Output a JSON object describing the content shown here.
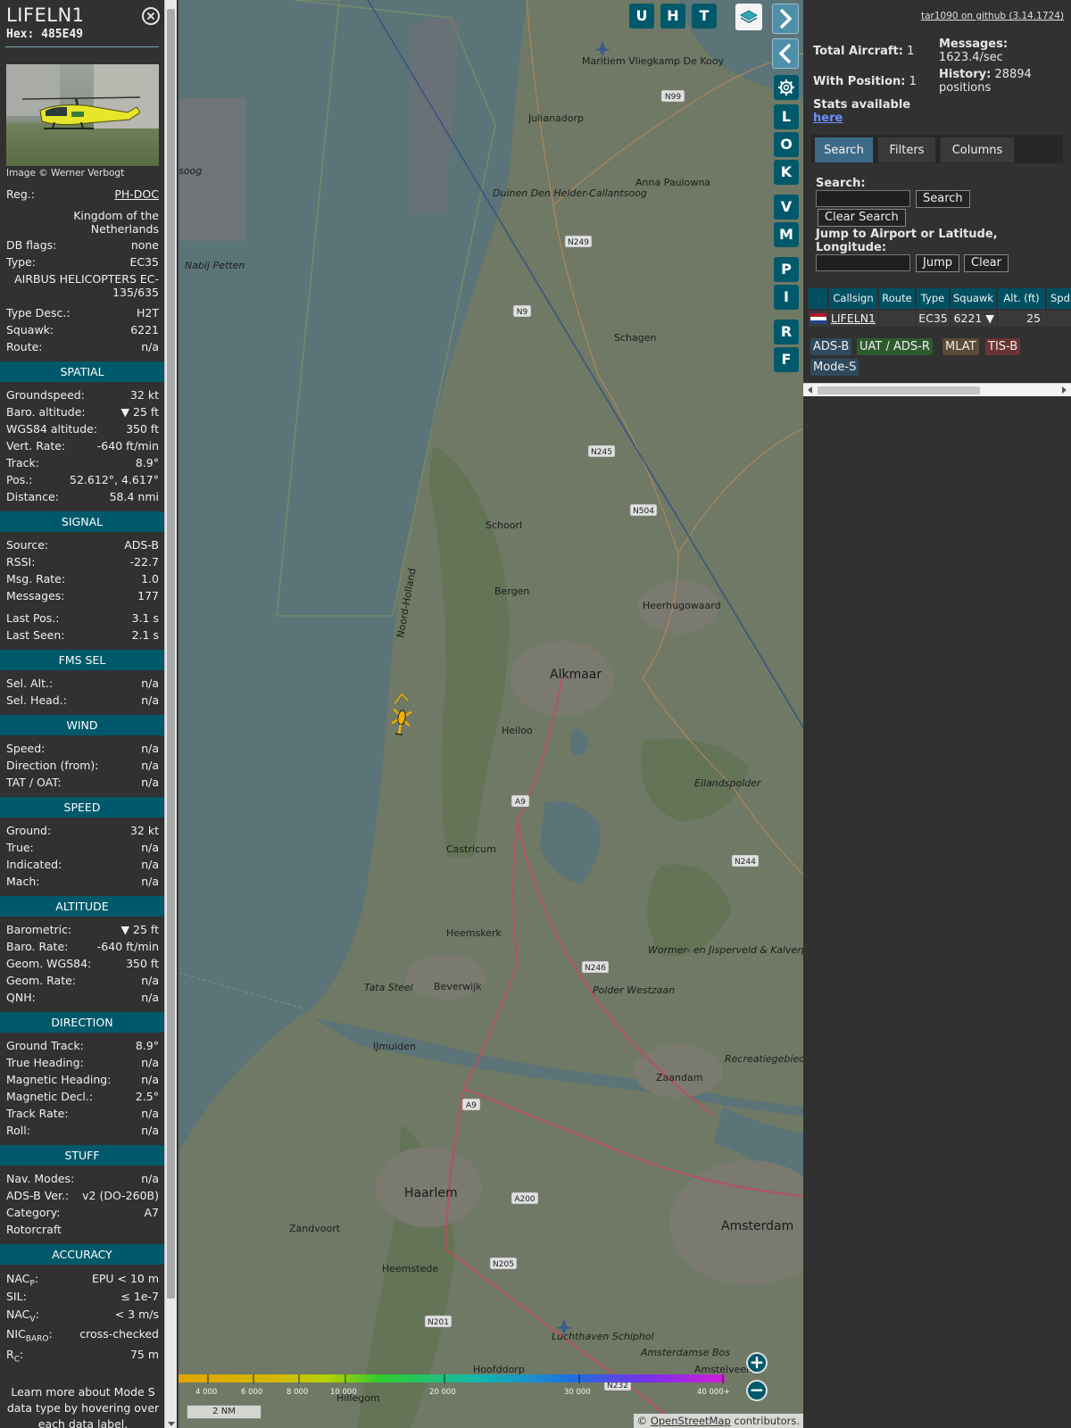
{
  "aircraft": {
    "callsign": "LIFELN1",
    "hex_label": "Hex: 485E49",
    "photo_credit": "Image © Werner Verbogt",
    "reg_label": "Reg.:",
    "reg": "PH-DOC",
    "country": "Kingdom of the Netherlands",
    "dbflags_label": "DB flags:",
    "dbflags": "none",
    "type_label": "Type:",
    "type": "EC35",
    "type_full": "AIRBUS HELICOPTERS EC-135/635",
    "typedesc_label": "Type Desc.:",
    "typedesc": "H2T",
    "squawk_label": "Squawk:",
    "squawk": "6221",
    "route_label": "Route:",
    "route": "n/a"
  },
  "sections": {
    "spatial": {
      "title": "SPATIAL",
      "rows": [
        {
          "label": "Groundspeed:",
          "value": "32 kt"
        },
        {
          "label": "Baro. altitude:",
          "value": "▼ 25 ft"
        },
        {
          "label": "WGS84 altitude:",
          "value": "350 ft"
        },
        {
          "label": "Vert. Rate:",
          "value": "-640 ft/min"
        },
        {
          "label": "Track:",
          "value": "8.9°"
        },
        {
          "label": "Pos.:",
          "value": "52.612°, 4.617°"
        },
        {
          "label": "Distance:",
          "value": "58.4 nmi"
        }
      ]
    },
    "signal": {
      "title": "SIGNAL",
      "rows": [
        {
          "label": "Source:",
          "value": "ADS-B"
        },
        {
          "label": "RSSI:",
          "value": "-22.7"
        },
        {
          "label": "Msg. Rate:",
          "value": "1.0"
        },
        {
          "label": "Messages:",
          "value": "177"
        },
        {
          "label": "Last Pos.:",
          "value": "3.1 s"
        },
        {
          "label": "Last Seen:",
          "value": "2.1 s"
        }
      ]
    },
    "fms": {
      "title": "FMS SEL",
      "rows": [
        {
          "label": "Sel. Alt.:",
          "value": "n/a"
        },
        {
          "label": "Sel. Head.:",
          "value": "n/a"
        }
      ]
    },
    "wind": {
      "title": "WIND",
      "rows": [
        {
          "label": "Speed:",
          "value": "n/a"
        },
        {
          "label": "Direction (from):",
          "value": "n/a"
        },
        {
          "label": "TAT / OAT:",
          "value": "n/a"
        }
      ]
    },
    "speed": {
      "title": "SPEED",
      "rows": [
        {
          "label": "Ground:",
          "value": "32 kt"
        },
        {
          "label": "True:",
          "value": "n/a"
        },
        {
          "label": "Indicated:",
          "value": "n/a"
        },
        {
          "label": "Mach:",
          "value": "n/a"
        }
      ]
    },
    "altitude": {
      "title": "ALTITUDE",
      "rows": [
        {
          "label": "Barometric:",
          "value": "▼ 25 ft"
        },
        {
          "label": "Baro. Rate:",
          "value": "-640 ft/min"
        },
        {
          "label": "Geom. WGS84:",
          "value": "350 ft"
        },
        {
          "label": "Geom. Rate:",
          "value": "n/a"
        },
        {
          "label": "QNH:",
          "value": "n/a"
        }
      ]
    },
    "direction": {
      "title": "DIRECTION",
      "rows": [
        {
          "label": "Ground Track:",
          "value": "8.9°"
        },
        {
          "label": "True Heading:",
          "value": "n/a"
        },
        {
          "label": "Magnetic Heading:",
          "value": "n/a"
        },
        {
          "label": "Magnetic Decl.:",
          "value": "2.5°"
        },
        {
          "label": "Track Rate:",
          "value": "n/a"
        },
        {
          "label": "Roll:",
          "value": "n/a"
        }
      ]
    },
    "stuff": {
      "title": "STUFF",
      "rows": [
        {
          "label": "Nav. Modes:",
          "value": "n/a"
        },
        {
          "label": "ADS-B Ver.:",
          "value": "v2 (DO-260B)"
        },
        {
          "label": "Category:",
          "value": "A7"
        }
      ],
      "category_desc": "Rotorcraft"
    },
    "accuracy": {
      "title": "ACCURACY",
      "rows": [
        {
          "label": "NAC",
          "sub": "P",
          "value": "EPU < 10 m"
        },
        {
          "label": "SIL:",
          "sub": "",
          "value": "≤ 1e-7"
        },
        {
          "label": "NAC",
          "sub": "V",
          "value": "< 3 m/s"
        },
        {
          "label": "NIC",
          "sub": "BARO",
          "value": "cross-checked"
        },
        {
          "label": "R",
          "sub": "C",
          "value": "75 m"
        }
      ],
      "footer": "Learn more about Mode S data type by hovering over each data label."
    }
  },
  "map": {
    "buttons_top": [
      "U",
      "H",
      "T"
    ],
    "buttons_side": [
      "L",
      "O",
      "K",
      "V",
      "M",
      "P",
      "I",
      "R",
      "F"
    ],
    "labels": {
      "julianadorp": "Julianadorp",
      "anna_paulowna": "Anna Paulowna",
      "duinen": "Duinen Den Helder-Callantsoog",
      "nabij_petten": "Nabij Petten",
      "soog": "soog",
      "maritiem": "Maritiem Vliegkamp De Kooy",
      "schagen": "Schagen",
      "schoorl": "Schoorl",
      "bergen": "Bergen",
      "heerhugowaard": "Heerhugowaard",
      "alkmaar": "Alkmaar",
      "heiloo": "Heiloo",
      "eilandspolder": "Eilandspolder",
      "noord_holland": "Noord-Holland",
      "castricum": "Castricum",
      "heemskerk": "Heemskerk",
      "wormer": "Wormer- en Jisperveld & Kalverpolder",
      "tata_steel": "Tata Steel",
      "beverwijk": "Beverwijk",
      "polder_westzaan": "Polder Westzaan",
      "ijmuiden": "IJmuiden",
      "zaandam": "Zaandam",
      "recreatiegebied": "Recreatiegebied Het Twiske",
      "haarlem": "Haarlem",
      "zandvoort": "Zandvoort",
      "amsterdam": "Amsterdam",
      "heemstede": "Heemstede",
      "luchthaven": "Luchthaven Schiphol",
      "amsterdamse_bos": "Amsterdamse Bos",
      "hoofddorp": "Hoofddorp",
      "hillegom": "Hillegom",
      "amstelveen": "Amstelveen"
    },
    "roads": [
      "N99",
      "N249",
      "N9",
      "N245",
      "N504",
      "A9",
      "N244",
      "N246",
      "A9",
      "A200",
      "N205",
      "N201",
      "N232"
    ],
    "color_scale": [
      "4 000",
      "6 000",
      "8 000",
      "10 000",
      "20 000",
      "30 000",
      "40 000+"
    ],
    "scale": "2 NM",
    "attribution_prefix": "© ",
    "attribution_link": "OpenStreetMap",
    "attribution_suffix": " contributors.",
    "zoom_in": "+",
    "zoom_out": "−"
  },
  "panel": {
    "github": "tar1090 on github (3.14.1724)",
    "total_label": "Total Aircraft:",
    "total": "1",
    "with_pos_label": "With Position:",
    "with_pos": "1",
    "messages_label": "Messages:",
    "messages": "1623.4/sec",
    "history_label": "History:",
    "history": "28894 positions",
    "stats_label": "Stats available",
    "stats_link": "here",
    "tabs": [
      "Search",
      "Filters",
      "Columns"
    ],
    "search_label": "Search:",
    "search_button": "Search",
    "clear_search": "Clear Search",
    "jump_label": "Jump to Airport or Latitude, Longitude:",
    "jump_button": "Jump",
    "clear_button": "Clear",
    "table_headers": [
      "Callsign",
      "Route",
      "Type",
      "Squawk",
      "Alt. (ft)",
      "Spd"
    ],
    "table_row": {
      "callsign": "LIFELN1",
      "route": "",
      "type": "EC35",
      "squawk": "6221",
      "alt_arrow": "▼",
      "alt": "25"
    },
    "badges": [
      "ADS-B",
      "UAT / ADS-R",
      "MLAT",
      "TIS-B",
      "Mode-S"
    ],
    "badge_colors": [
      "#2f4a5c",
      "#2e5a2e",
      "#5a4a37",
      "#6a3434",
      "#2f4a5c"
    ]
  }
}
